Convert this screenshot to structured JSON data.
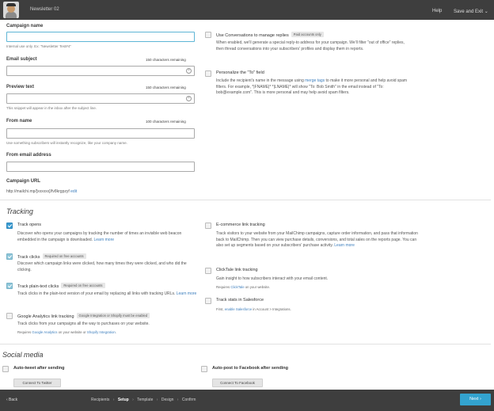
{
  "header": {
    "doc_title": "Newsletter 02",
    "help": "Help",
    "save_exit": "Save and Exit",
    "chevron": "⌄"
  },
  "setup": {
    "campaign_name": {
      "label": "Campaign name",
      "value": "",
      "help": "Internal use only. Ex: \"Newsletter Test#4\""
    },
    "email_subject": {
      "label": "Email subject",
      "remaining": "150 characters remaining",
      "value": ""
    },
    "preview_text": {
      "label": "Preview text",
      "remaining": "150 characters remaining",
      "value": "",
      "help": "This snippet will appear in the inbox after the subject line."
    },
    "from_name": {
      "label": "From name",
      "remaining": "100 characters remaining",
      "value": "",
      "help": "Use something subscribers will instantly recognize, like your company name."
    },
    "from_email": {
      "label": "From email address",
      "value": ""
    },
    "campaign_url": {
      "label": "Campaign URL",
      "value": "http://mailchi.mp/[xxxxxx]/fv8krgpzyf",
      "edit": "edit"
    }
  },
  "options": {
    "conversations": {
      "title": "Use Conversations to manage replies",
      "badge": "Paid accounts only",
      "desc": "When enabled, we'll generate a special reply-to address for your campaign. We'll filter \"out of office\" replies, then thread conversations into your subscribers' profiles and display them in reports."
    },
    "personalize_to": {
      "title": "Personalize the \"To\" field",
      "desc_before": "Include the recipient's name in the message using ",
      "link": "merge tags",
      "desc_after": " to make it more personal and help avoid spam filters. For example, *|FNAME|* *|LNAME|* will show \"To: Bob Smith\" in the email instead of \"To: bob@example.com\". This is more personal and may help avoid spam filters."
    }
  },
  "tracking": {
    "heading": "Tracking",
    "opens": {
      "title": "Track opens",
      "desc": "Discover who opens your campaigns by tracking the number of times an invisible web beacon embedded in the campaign is downloaded. ",
      "link": "Learn more",
      "checked": true
    },
    "clicks": {
      "title": "Track clicks",
      "badge": "Required on free accounts",
      "desc": "Discover which campaign links were clicked, how many times they were clicked, and who did the clicking.",
      "checked": true
    },
    "plain_text": {
      "title": "Track plain-text clicks",
      "badge": "Required on free accounts",
      "desc": "Track clicks in the plain-text version of your email by replacing all links with tracking URLs. ",
      "link": "Learn more",
      "checked": true
    },
    "google": {
      "title": "Google Analytics link tracking",
      "badge": "Google Integration or Shopify must be enabled",
      "desc": "Track clicks from your campaigns all the way to purchases on your website.",
      "small_before": "Requires ",
      "small_link1": "Google Analytics",
      "small_mid": " on your website or ",
      "small_link2": "Shopify Integration",
      "small_after": ".",
      "checked": false
    },
    "ecommerce": {
      "title": "E-commerce link tracking",
      "desc": "Track visitors to your website from your MailChimp campaigns, capture order information, and pass that information back to MailChimp. Then you can view purchase details, conversions, and total sales on the reports page. You can also set up segments based on your subscribers' purchase activity. ",
      "link": "Learn more",
      "checked": false
    },
    "clicktale": {
      "title": "ClickTale link tracking",
      "desc": "Gain insight to how subscribers interact with your email content.",
      "small_before": "Requires ",
      "small_link": "ClickTale",
      "small_after": " on your website.",
      "checked": false
    },
    "salesforce": {
      "title": "Track stats in Salesforce",
      "small_before": "First, ",
      "small_link": "enable Salesforce",
      "small_after": " in Account > Integrations.",
      "checked": false
    }
  },
  "social": {
    "heading": "Social media",
    "twitter": {
      "title": "Auto-tweet after sending",
      "button": "Connect To Twitter"
    },
    "facebook": {
      "title": "Auto-post to Facebook after sending",
      "button": "Connect To Facebook"
    }
  },
  "footer": {
    "back": "‹  Back",
    "steps": [
      "Recipients",
      "Setup",
      "Template",
      "Design",
      "Confirm"
    ],
    "current_step": "Setup",
    "separator": "›",
    "next": "Next  ›"
  }
}
